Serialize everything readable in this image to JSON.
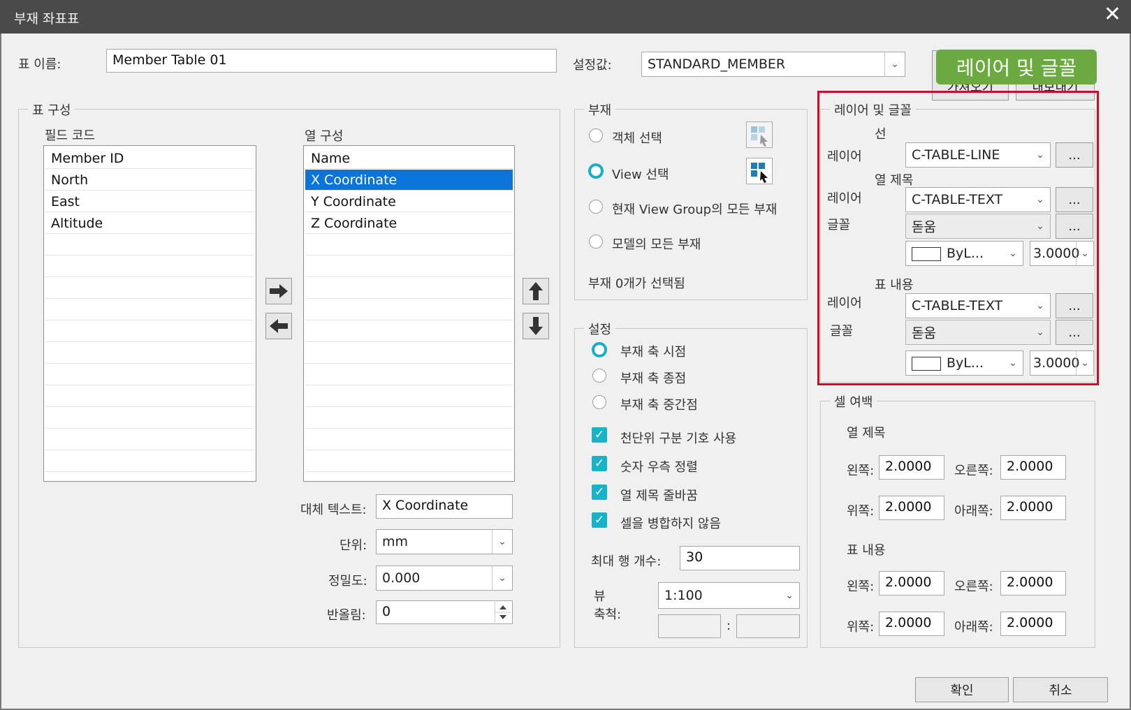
{
  "window": {
    "title": "부재 좌표표",
    "close": "✕"
  },
  "top": {
    "table_name_label": "표 이름:",
    "table_name_value": "Member Table 01",
    "preset_label": "설정값:",
    "preset_value": "STANDARD_MEMBER",
    "btn_load": "가져오기",
    "btn_export": "내보내기",
    "tooltip": "레이어 및 글꼴"
  },
  "table_config": {
    "group_label": "표 구성",
    "field_code_label": "필드 코드",
    "field_codes": [
      "Member ID",
      "North",
      "East",
      "Altitude"
    ],
    "column_config_label": "열 구성",
    "columns": [
      "Name",
      "X Coordinate",
      "Y Coordinate",
      "Z Coordinate"
    ],
    "selected_column": "X Coordinate",
    "alt_text_label": "대체 텍스트:",
    "alt_text_value": "X Coordinate",
    "unit_label": "단위:",
    "unit_value": "mm",
    "precision_label": "정밀도:",
    "precision_value": "0.000",
    "rounding_label": "반올림:",
    "rounding_value": "0"
  },
  "members": {
    "group_label": "부재",
    "options": [
      "객체 선택",
      "View 선택",
      "현재 View Group의 모든 부재",
      "모델의 모든 부재"
    ],
    "selected": "View 선택",
    "status": "부재 0개가 선택됨"
  },
  "settings": {
    "group_label": "설정",
    "radios": [
      "부재 축 시점",
      "부재 축 종점",
      "부재 축 중간점"
    ],
    "selected": "부재 축 시점",
    "checks": [
      "천단위 구분 기호 사용",
      "숫자 우측 정렬",
      "열 제목 줄바꿈",
      "셀을 병합하지 않음"
    ],
    "max_rows_label": "최대 행 개수:",
    "max_rows_value": "30",
    "view_scale_label_1": "뷰",
    "view_scale_label_2": "축척:",
    "view_scale_value": "1:100",
    "colon": ":"
  },
  "layer_font": {
    "group_label": "레이어 및 글꼴",
    "line_header": "선",
    "layer_label": "레이어",
    "font_label": "글꼴",
    "line_layer": "C-TABLE-LINE",
    "col_title_header": "열 제목",
    "col_title_layer": "C-TABLE-TEXT",
    "col_title_font": "돋움",
    "col_title_color": "ByL...",
    "col_title_height": "3.0000",
    "content_header": "표 내용",
    "content_layer": "C-TABLE-TEXT",
    "content_font": "돋움",
    "content_color": "ByL...",
    "content_height": "3.0000",
    "ellipsis": "..."
  },
  "cell_margin": {
    "group_label": "셀 여백",
    "col_title_header": "열 제목",
    "content_header": "표 내용",
    "left_label": "왼쪽:",
    "right_label": "오른쪽:",
    "top_label": "위쪽:",
    "bottom_label": "아래쪽:",
    "col_left": "2.0000",
    "col_right": "2.0000",
    "col_top": "2.0000",
    "col_bottom": "2.0000",
    "cnt_left": "2.0000",
    "cnt_right": "2.0000",
    "cnt_top": "2.0000",
    "cnt_bottom": "2.0000"
  },
  "footer": {
    "ok": "확인",
    "cancel": "취소"
  },
  "icons": [
    "close-icon",
    "arrow-right-icon",
    "arrow-left-icon",
    "arrow-up-icon",
    "arrow-down-icon",
    "select-object-icon",
    "select-view-icon",
    "chevron-down-icon",
    "spin-icon"
  ]
}
